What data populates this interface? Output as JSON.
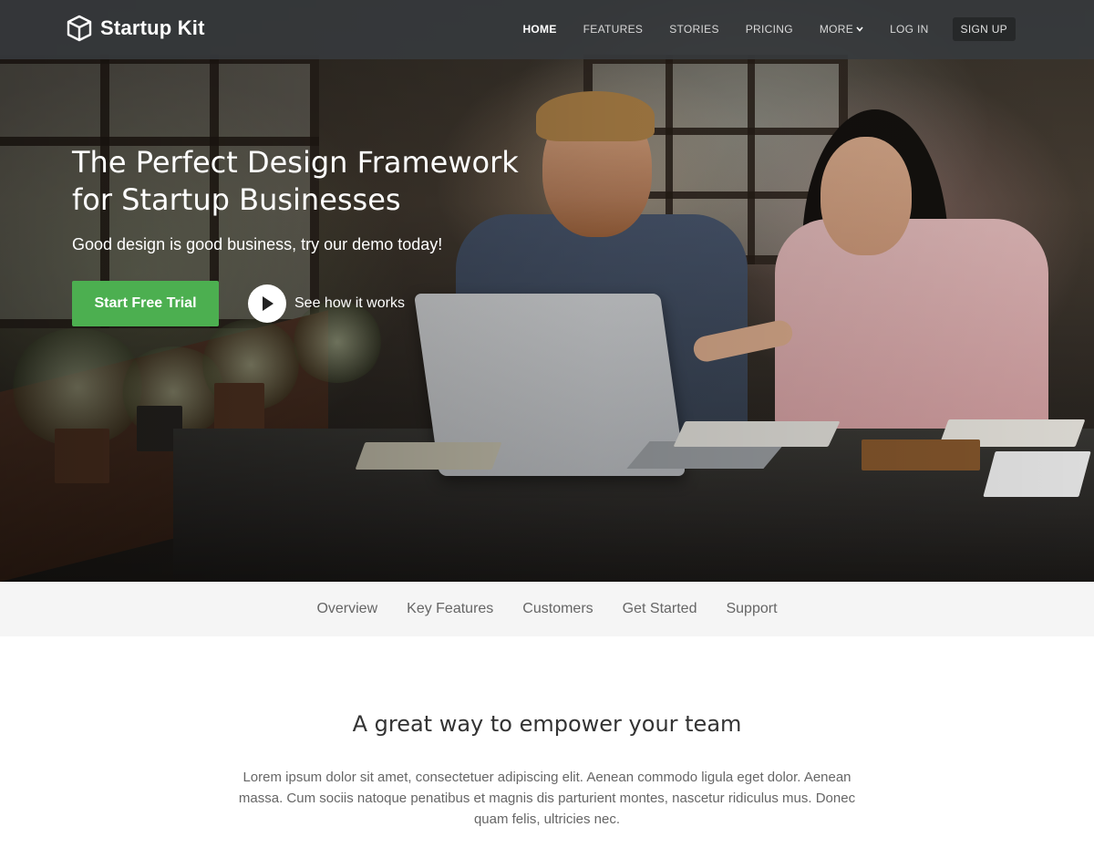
{
  "brand": {
    "name": "Startup Kit",
    "icon": "cube-icon"
  },
  "nav": {
    "items": [
      {
        "label": "HOME",
        "active": true
      },
      {
        "label": "FEATURES",
        "active": false
      },
      {
        "label": "STORIES",
        "active": false
      },
      {
        "label": "PRICING",
        "active": false
      },
      {
        "label": "MORE",
        "active": false,
        "icon": "chevron-down-icon"
      },
      {
        "label": "LOG IN",
        "active": false
      }
    ],
    "signup_label": "SIGN UP"
  },
  "hero": {
    "title": "The Perfect Design Framework for Startup Businesses",
    "subtitle": "Good design is good business, try our demo today!",
    "cta_label": "Start Free Trial",
    "play_label": "See how it works",
    "play_icon": "play-icon"
  },
  "subnav": {
    "items": [
      "Overview",
      "Key Features",
      "Customers",
      "Get Started",
      "Support"
    ]
  },
  "section": {
    "title": "A great way to empower your team",
    "body": "Lorem ipsum dolor sit amet, consectetuer adipiscing elit. Aenean commodo ligula eget dolor. Aenean massa. Cum sociis natoque penatibus et magnis dis parturient montes, nascetur ridiculus mus. Donec quam felis, ultricies nec."
  },
  "colors": {
    "accent_green": "#4caf50",
    "navbar_bg": "#373a3e",
    "subnav_bg": "#f5f5f5",
    "signup_bg": "#262829"
  }
}
